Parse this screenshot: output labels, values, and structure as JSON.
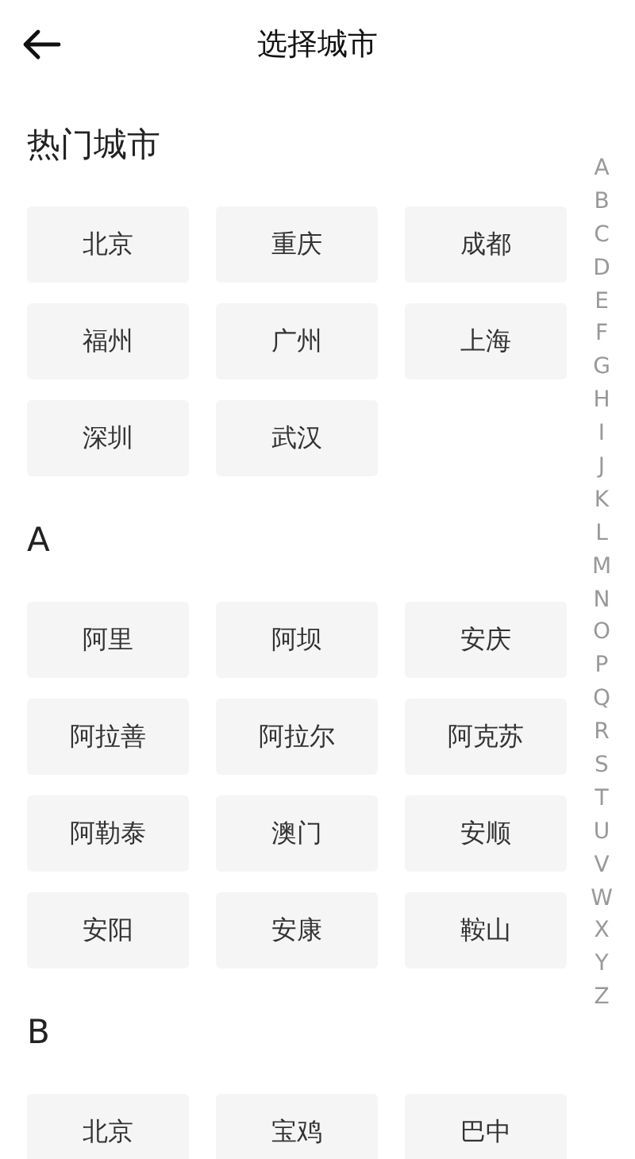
{
  "header": {
    "title": "选择城市"
  },
  "sections": [
    {
      "heading": "热门城市",
      "cities": [
        "北京",
        "重庆",
        "成都",
        "福州",
        "广州",
        "上海",
        "深圳",
        "武汉"
      ]
    },
    {
      "heading": "A",
      "cities": [
        "阿里",
        "阿坝",
        "安庆",
        "阿拉善",
        "阿拉尔",
        "阿克苏",
        "阿勒泰",
        "澳门",
        "安顺",
        "安阳",
        "安康",
        "鞍山"
      ]
    },
    {
      "heading": "B",
      "cities": [
        "北京",
        "宝鸡",
        "巴中"
      ]
    }
  ],
  "index": [
    "A",
    "B",
    "C",
    "D",
    "E",
    "F",
    "G",
    "H",
    "I",
    "J",
    "K",
    "L",
    "M",
    "N",
    "O",
    "P",
    "Q",
    "R",
    "S",
    "T",
    "U",
    "V",
    "W",
    "X",
    "Y",
    "Z"
  ]
}
